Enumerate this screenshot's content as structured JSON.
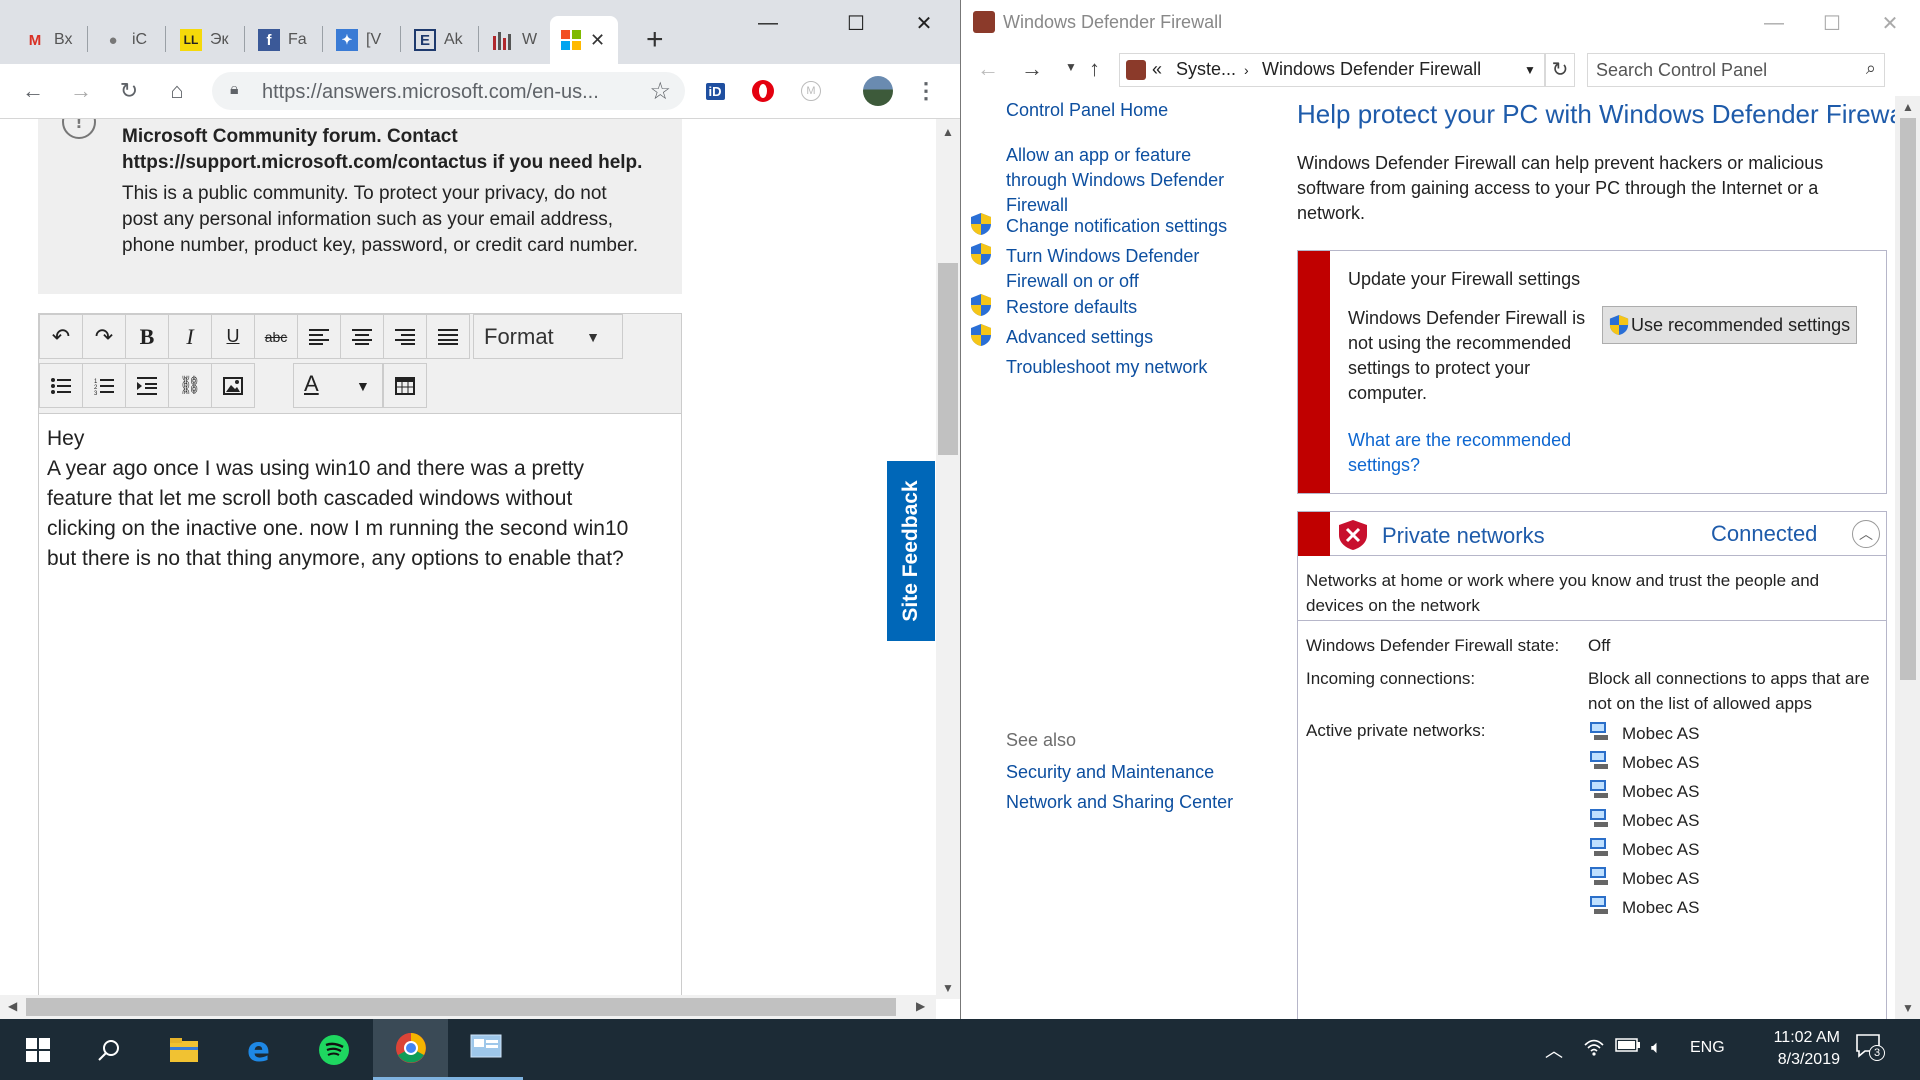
{
  "chrome": {
    "tabs": [
      {
        "label": "Вх",
        "icon": "gmail-icon"
      },
      {
        "label": "iC",
        "icon": "apple-icon"
      },
      {
        "label": "Эк",
        "icon": "ll-icon"
      },
      {
        "label": "Fa",
        "icon": "facebook-icon"
      },
      {
        "label": "[V",
        "icon": "vk-icon"
      },
      {
        "label": "Ak",
        "icon": "e-icon"
      },
      {
        "label": "W",
        "icon": "chart-icon"
      },
      {
        "label": "",
        "icon": "microsoft-icon",
        "active": true
      }
    ],
    "url": "https://answers.microsoft.com/en-us...",
    "notice_bold": "Microsoft Community forum. Contact https://support.microsoft.com/contactus if you need help.",
    "notice_body": "This is a public community. To protect your privacy, do not post any personal information such as your email address, phone number, product key, password, or credit card number.",
    "format_label": "Format",
    "editor_lines": [
      "Hey",
      "A year ago once I was using win10 and there was a pretty",
      "feature that let me scroll both cascaded windows without",
      "clicking on the inactive one. now I m running the second win10",
      "but there is no that thing anymore, any options to enable that?"
    ],
    "site_feedback": "Site Feedback"
  },
  "cp": {
    "title": "Windows Defender Firewall",
    "crumb_1": "Syste...",
    "crumb_2": "Windows Defender Firewall",
    "search_placeholder": "Search Control Panel",
    "nav": {
      "home": "Control Panel Home",
      "allow_app": "Allow an app or feature through Windows Defender Firewall",
      "change_notification": "Change notification settings",
      "turn_on_off": "Turn Windows Defender Firewall on or off",
      "restore_defaults": "Restore defaults",
      "advanced": "Advanced settings",
      "troubleshoot": "Troubleshoot my network",
      "see_also": "See also",
      "security_maintenance": "Security and Maintenance",
      "network_sharing": "Network and Sharing Center"
    },
    "heading": "Help protect your PC with Windows Defender Firewall",
    "intro": "Windows Defender Firewall can help prevent hackers or malicious software from gaining access to your PC through the Internet or a network.",
    "alert": {
      "title": "Update your Firewall settings",
      "message": "Windows Defender Firewall is not using the recommended settings to protect your computer.",
      "button": "Use recommended settings",
      "link": "What are the recommended settings?"
    },
    "private": {
      "name": "Private networks",
      "status": "Connected",
      "description": "Networks at home or work where you know and trust the people and devices on the network",
      "state_label": "Windows Defender Firewall state:",
      "state_value": "Off",
      "incoming_label": "Incoming connections:",
      "incoming_value": "Block all connections to apps that are not on the list of allowed apps",
      "active_label": "Active private networks:",
      "networks": [
        "Mobec AS",
        "Mobec AS",
        "Mobec AS",
        "Mobec AS",
        "Mobec AS",
        "Mobec AS",
        "Mobec AS"
      ]
    }
  },
  "taskbar": {
    "language": "ENG",
    "time": "11:02 AM",
    "date": "8/3/2019",
    "notification_count": "3"
  }
}
